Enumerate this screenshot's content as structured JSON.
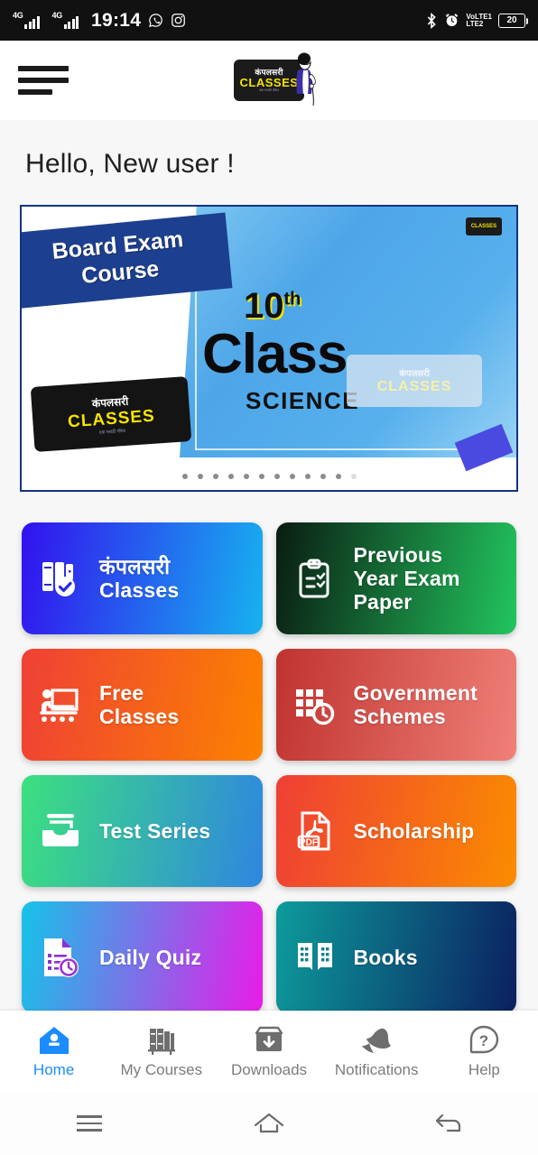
{
  "status_bar": {
    "network_1": "4G",
    "network_2": "4G",
    "time": "19:14",
    "app_icon_1": "whatsapp-icon",
    "app_icon_2": "instagram-icon",
    "bluetooth": "bluetooth-icon",
    "alarm": "alarm-icon",
    "volte_line1": "VoLTE1",
    "volte_line2": "LTE2",
    "battery_level": "20"
  },
  "header": {
    "menu_icon": "hamburger-menu-icon",
    "logo_hindi": "कंपलसरी",
    "logo_text": "CLASSES",
    "logo_subtitle": "एक मराठी चॅनेल"
  },
  "greeting": "Hello, New user !",
  "banner": {
    "ribbon_line1": "Board Exam",
    "ribbon_line2": "Course",
    "class_number": "10",
    "class_suffix": "th",
    "class_word": "Class",
    "subject": "SCIENCE",
    "card_left_hindi": "कंपलसरी",
    "card_left_text": "CLASSES",
    "card_left_sub": "एक मराठी चॅनेल",
    "card_right_hindi": "कंपलसरी",
    "card_right_text": "CLASSES",
    "logo_badge": "CLASSES",
    "dot_count": 11,
    "border_color": "#12357f"
  },
  "tiles": [
    {
      "id": "compulsory-classes",
      "line1": "कंपलसरी",
      "line2": "Classes",
      "icon": "books-check-icon",
      "gradient_from": "#3311ee",
      "gradient_to": "#17b2ef"
    },
    {
      "id": "previous-year-exam-paper",
      "line1": "Previous",
      "line2": "Year Exam",
      "line3": "Paper",
      "icon": "clipboard-list-icon",
      "gradient_from": "#0a1c12",
      "gradient_to": "#22c55e"
    },
    {
      "id": "free-classes",
      "line1": "Free",
      "line2": "Classes",
      "icon": "teacher-board-icon",
      "gradient_from": "#ef4036",
      "gradient_to": "#fb8200"
    },
    {
      "id": "government-schemes",
      "line1": "Government",
      "line2": "Schemes",
      "icon": "calendar-clock-icon",
      "gradient_from": "#c0332f",
      "gradient_to": "#ef8078"
    },
    {
      "id": "test-series",
      "line1": "Test Series",
      "icon": "inbox-tray-icon",
      "gradient_from": "#3ce07f",
      "gradient_to": "#2f86e0"
    },
    {
      "id": "scholarship",
      "line1": "Scholarship",
      "icon": "pdf-file-icon",
      "gradient_from": "#ef3f35",
      "gradient_to": "#fa8c00"
    },
    {
      "id": "daily-quiz",
      "line1": "Daily Quiz",
      "icon": "quiz-timer-icon",
      "gradient_from": "#15c3e8",
      "gradient_to": "#e81ce8"
    },
    {
      "id": "books",
      "line1": "Books",
      "icon": "open-book-icon",
      "gradient_from": "#0d9b9b",
      "gradient_to": "#0b2060"
    }
  ],
  "bottom_nav": {
    "active": "Home",
    "active_color": "#1a8cff",
    "items": [
      {
        "label": "Home",
        "icon": "home-icon"
      },
      {
        "label": "My Courses",
        "icon": "books-shelf-icon"
      },
      {
        "label": "Downloads",
        "icon": "download-box-icon"
      },
      {
        "label": "Notifications",
        "icon": "bell-icon"
      },
      {
        "label": "Help",
        "icon": "question-mark-icon"
      }
    ]
  },
  "system_nav": {
    "recents": "recents-icon",
    "home": "home-outline-icon",
    "back": "back-arrow-icon"
  }
}
